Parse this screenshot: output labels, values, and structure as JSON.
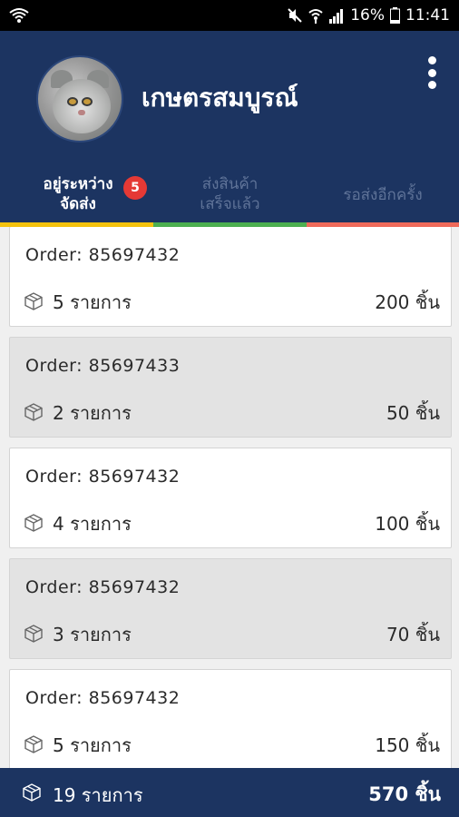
{
  "status_bar": {
    "battery": "16%",
    "time": "11:41",
    "icons": [
      "wifi-icon",
      "mute-icon",
      "wifi-signal-icon",
      "cell-signal-icon",
      "battery-icon"
    ]
  },
  "header": {
    "shop_name": "เกษตรสมบูรณ์",
    "avatar": "cat-avatar",
    "menu_icon": "more-vert-icon",
    "background": "#1c3461"
  },
  "tabs": [
    {
      "line1": "อยู่ระหว่าง",
      "line2": "จัดส่ง",
      "badge": "5",
      "active": true,
      "color": "#f4c20d"
    },
    {
      "line1": "ส่งสินค้า",
      "line2": "เสร็จแล้ว",
      "active": false,
      "color": "#4caf50"
    },
    {
      "label": "รอส่งอีกครั้ง",
      "active": false,
      "color": "#ef6a5a"
    }
  ],
  "orders": [
    {
      "order_label": "Order: 85697432",
      "items": "5 รายการ",
      "qty": "200 ชิ้น",
      "style": "white"
    },
    {
      "order_label": "Order: 85697433",
      "items": "2 รายการ",
      "qty": "50 ชิ้น",
      "style": "grey"
    },
    {
      "order_label": "Order: 85697432",
      "items": "4 รายการ",
      "qty": "100 ชิ้น",
      "style": "white"
    },
    {
      "order_label": "Order: 85697432",
      "items": "3 รายการ",
      "qty": "70 ชิ้น",
      "style": "grey"
    },
    {
      "order_label": "Order: 85697432",
      "items": "5 รายการ",
      "qty": "150 ชิ้น",
      "style": "white"
    }
  ],
  "footer": {
    "total_items": "19 รายการ",
    "total_qty": "570 ชิ้น"
  }
}
